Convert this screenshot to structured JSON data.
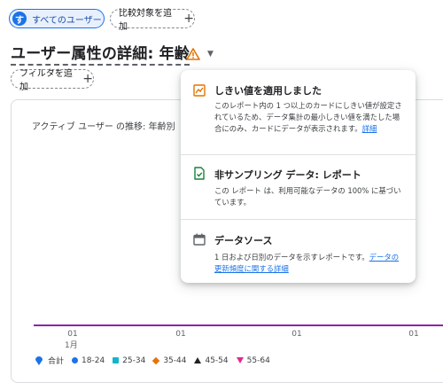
{
  "header": {
    "audience_chip": {
      "avatar": "す",
      "label": "すべてのユーザー"
    },
    "compare_chip": {
      "label": "比較対象を追加",
      "icon": "plus-icon"
    },
    "title": "ユーザー属性の詳細: 年齢",
    "filter_chip": {
      "label": "フィルタを追加",
      "icon": "plus-icon"
    }
  },
  "chart": {
    "title": "アクティブ ユーザー の推移: 年齢別",
    "x_ticks": [
      "01",
      "01",
      "01",
      "01"
    ],
    "x_sub": "1月",
    "line_color": "#8e24aa",
    "legend": [
      {
        "label": "合計",
        "color": "#1a73e8",
        "marker": "pin"
      },
      {
        "label": "18-24",
        "color": "#1a73e8",
        "marker": "dot"
      },
      {
        "label": "25-34",
        "color": "#12b5cb",
        "marker": "square"
      },
      {
        "label": "35-44",
        "color": "#e8710a",
        "marker": "diamond"
      },
      {
        "label": "45-54",
        "color": "#222222",
        "marker": "triangle-up"
      },
      {
        "label": "55-64",
        "color": "#e52592",
        "marker": "triangle-down"
      }
    ]
  },
  "popover": {
    "threshold": {
      "icon": "chart-icon",
      "heading": "しきい値を適用しました",
      "body": "このレポート内の 1 つ以上のカードにしきい値が設定されているため、データ集計の最小しきい値を満たした場合にのみ、カードにデータが表示されます。",
      "link": "詳細"
    },
    "sampling": {
      "icon": "check-file-icon",
      "heading": "非サンプリング データ: レポート",
      "body": "この レポート は、利用可能なデータの 100% に基づいています。"
    },
    "datasource": {
      "icon": "calendar-icon",
      "heading": "データソース",
      "body": "1 日および日別のデータを示すレポートです。",
      "link": "データの更新頻度に関する詳細"
    }
  },
  "colors": {
    "accent": "#1a73e8",
    "warning": "#e37400",
    "series_line": "#8e24aa"
  }
}
